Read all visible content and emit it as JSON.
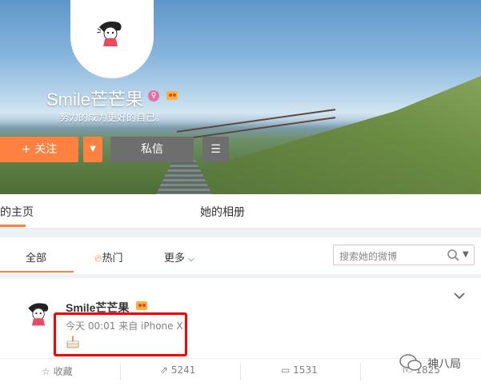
{
  "profile": {
    "username": "Smile芒芒果",
    "bio": "努力的成为更好的自己。",
    "follow_label": "+ 关注",
    "message_label": "私信"
  },
  "tabs": {
    "home": "的主页",
    "album": "她的相册"
  },
  "filters": {
    "all": "全部",
    "hot": "热门",
    "more": "更多",
    "search_placeholder": "搜索她的微博"
  },
  "post": {
    "author": "Smile芒芒果",
    "meta": "今天 00:01 来自 iPhone X"
  },
  "actions": {
    "favorite": "收藏",
    "repost": "5241",
    "comment": "1531",
    "like": "1825"
  },
  "watermark": {
    "text": "神八局"
  },
  "colors": {
    "accent": "#ff8140",
    "highlight": "#ff0000",
    "secondary_button": "#6e6e6e"
  }
}
